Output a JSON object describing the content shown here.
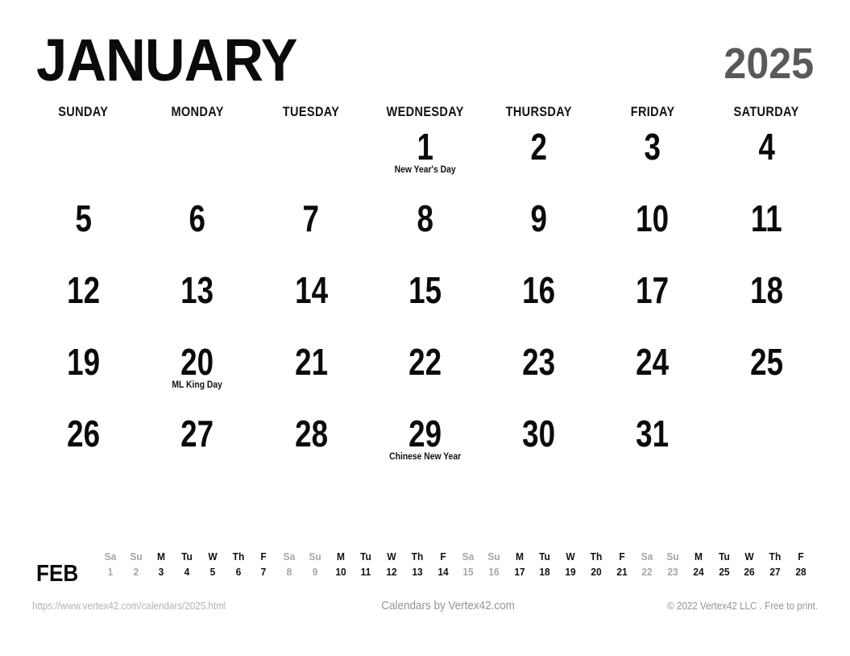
{
  "header": {
    "month": "JANUARY",
    "year": "2025"
  },
  "colors": {
    "text": "#0b0b0b",
    "year_gray": "#595959",
    "weekend_gray": "#a6a6a6",
    "footer_gray": "#949494",
    "background": "#ffffff"
  },
  "weekday_headers": [
    "SUNDAY",
    "MONDAY",
    "TUESDAY",
    "WEDNESDAY",
    "THURSDAY",
    "FRIDAY",
    "SATURDAY"
  ],
  "weeks": [
    [
      {
        "day": "",
        "event": ""
      },
      {
        "day": "",
        "event": ""
      },
      {
        "day": "",
        "event": ""
      },
      {
        "day": "1",
        "event": "New Year's Day"
      },
      {
        "day": "2",
        "event": ""
      },
      {
        "day": "3",
        "event": ""
      },
      {
        "day": "4",
        "event": ""
      }
    ],
    [
      {
        "day": "5",
        "event": ""
      },
      {
        "day": "6",
        "event": ""
      },
      {
        "day": "7",
        "event": ""
      },
      {
        "day": "8",
        "event": ""
      },
      {
        "day": "9",
        "event": ""
      },
      {
        "day": "10",
        "event": ""
      },
      {
        "day": "11",
        "event": ""
      }
    ],
    [
      {
        "day": "12",
        "event": ""
      },
      {
        "day": "13",
        "event": ""
      },
      {
        "day": "14",
        "event": ""
      },
      {
        "day": "15",
        "event": ""
      },
      {
        "day": "16",
        "event": ""
      },
      {
        "day": "17",
        "event": ""
      },
      {
        "day": "18",
        "event": ""
      }
    ],
    [
      {
        "day": "19",
        "event": ""
      },
      {
        "day": "20",
        "event": "ML King Day"
      },
      {
        "day": "21",
        "event": ""
      },
      {
        "day": "22",
        "event": ""
      },
      {
        "day": "23",
        "event": ""
      },
      {
        "day": "24",
        "event": ""
      },
      {
        "day": "25",
        "event": ""
      }
    ],
    [
      {
        "day": "26",
        "event": ""
      },
      {
        "day": "27",
        "event": ""
      },
      {
        "day": "28",
        "event": ""
      },
      {
        "day": "29",
        "event": "Chinese New Year"
      },
      {
        "day": "30",
        "event": ""
      },
      {
        "day": "31",
        "event": ""
      },
      {
        "day": "",
        "event": ""
      }
    ]
  ],
  "mini_month": {
    "label": "FEB",
    "days": [
      {
        "dow": "Sa",
        "num": "1",
        "weekend": true
      },
      {
        "dow": "Su",
        "num": "2",
        "weekend": true
      },
      {
        "dow": "M",
        "num": "3",
        "weekend": false
      },
      {
        "dow": "Tu",
        "num": "4",
        "weekend": false
      },
      {
        "dow": "W",
        "num": "5",
        "weekend": false
      },
      {
        "dow": "Th",
        "num": "6",
        "weekend": false
      },
      {
        "dow": "F",
        "num": "7",
        "weekend": false
      },
      {
        "dow": "Sa",
        "num": "8",
        "weekend": true
      },
      {
        "dow": "Su",
        "num": "9",
        "weekend": true
      },
      {
        "dow": "M",
        "num": "10",
        "weekend": false
      },
      {
        "dow": "Tu",
        "num": "11",
        "weekend": false
      },
      {
        "dow": "W",
        "num": "12",
        "weekend": false
      },
      {
        "dow": "Th",
        "num": "13",
        "weekend": false
      },
      {
        "dow": "F",
        "num": "14",
        "weekend": false
      },
      {
        "dow": "Sa",
        "num": "15",
        "weekend": true
      },
      {
        "dow": "Su",
        "num": "16",
        "weekend": true
      },
      {
        "dow": "M",
        "num": "17",
        "weekend": false
      },
      {
        "dow": "Tu",
        "num": "18",
        "weekend": false
      },
      {
        "dow": "W",
        "num": "19",
        "weekend": false
      },
      {
        "dow": "Th",
        "num": "20",
        "weekend": false
      },
      {
        "dow": "F",
        "num": "21",
        "weekend": false
      },
      {
        "dow": "Sa",
        "num": "22",
        "weekend": true
      },
      {
        "dow": "Su",
        "num": "23",
        "weekend": true
      },
      {
        "dow": "M",
        "num": "24",
        "weekend": false
      },
      {
        "dow": "Tu",
        "num": "25",
        "weekend": false
      },
      {
        "dow": "W",
        "num": "26",
        "weekend": false
      },
      {
        "dow": "Th",
        "num": "27",
        "weekend": false
      },
      {
        "dow": "F",
        "num": "28",
        "weekend": false
      }
    ]
  },
  "footer": {
    "url": "https://www.vertex42.com/calendars/2025.html",
    "credit": "Calendars by Vertex42.com",
    "copyright": "© 2022 Vertex42 LLC . Free to print."
  }
}
